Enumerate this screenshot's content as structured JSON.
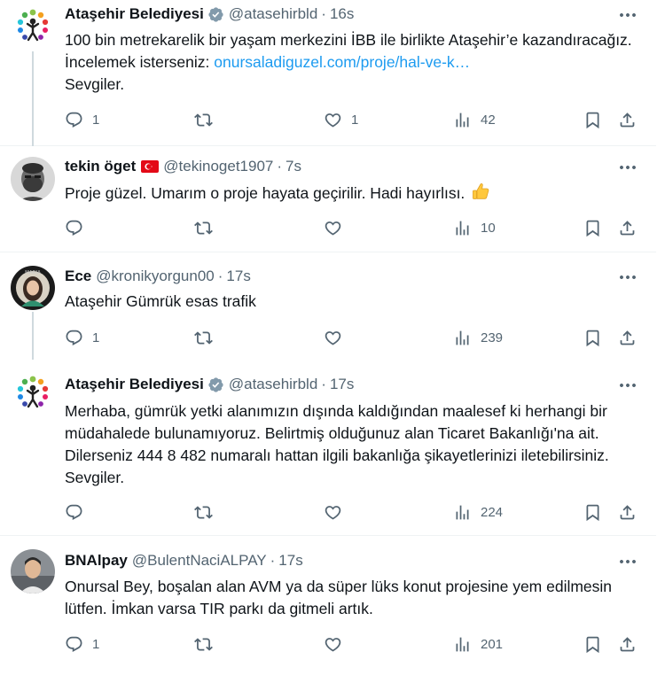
{
  "tweets": [
    {
      "name": "Ataşehir Belediyesi",
      "handle": "@atasehirbld",
      "time": "16s",
      "verified": true,
      "text_before_link": "100 bin metrekarelik bir yaşam merkezini İBB ile birlikte Ataşehir’e kazandıracağız. İncelemek isterseniz: ",
      "link": "onursaladiguzel.com/proje/hal-ve-k…",
      "text_after_link": "Sevgiler.",
      "replies": "1",
      "retweets": "",
      "likes": "1",
      "views": "42",
      "avatar": "atasehir-logo"
    },
    {
      "name": "tekin öget",
      "handle": "@tekinoget1907",
      "time": "7s",
      "flag": "turkey-flag",
      "text": "Proje güzel. Umarım o proje hayata geçirilir. Hadi hayırlısı.",
      "emoji": "thumbs-up",
      "replies": "",
      "retweets": "",
      "likes": "",
      "views": "10",
      "avatar": "bearded-man-photo"
    },
    {
      "name": "Ece",
      "handle": "@kronikyorgun00",
      "time": "17s",
      "text": "Ataşehir Gümrük esas trafik",
      "replies": "1",
      "retweets": "",
      "likes": "",
      "views": "239",
      "avatar": "woman-photo"
    },
    {
      "name": "Ataşehir Belediyesi",
      "handle": "@atasehirbld",
      "time": "17s",
      "verified": true,
      "text": "Merhaba, gümrük yetki alanımızın dışında kaldığından maalesef ki herhangi bir müdahalede bulunamıyoruz. Belirtmiş olduğunuz alan Ticaret Bakanlığı'na ait. Dilerseniz 444 8 482 numaralı hattan ilgili bakanlığa şikayetlerinizi iletebilirsiniz. Sevgiler.",
      "replies": "",
      "retweets": "",
      "likes": "",
      "views": "224",
      "avatar": "atasehir-logo"
    },
    {
      "name": "BNAlpay",
      "handle": "@BulentNaciALPAY",
      "time": "17s",
      "text": "Onursal Bey, boşalan alan AVM ya da süper lüks konut projesine yem edilmesin lütfen. İmkan varsa TIR parkı da gitmeli artık.",
      "replies": "1",
      "retweets": "",
      "likes": "",
      "views": "201",
      "avatar": "man-photo"
    }
  ],
  "colors": {
    "text": "#0f1419",
    "secondary": "#536471",
    "link": "#1d9bf0",
    "verified_badge": "#829aab",
    "thread_line": "#cfd9de",
    "divider": "#eff3f4"
  },
  "separator": "·"
}
